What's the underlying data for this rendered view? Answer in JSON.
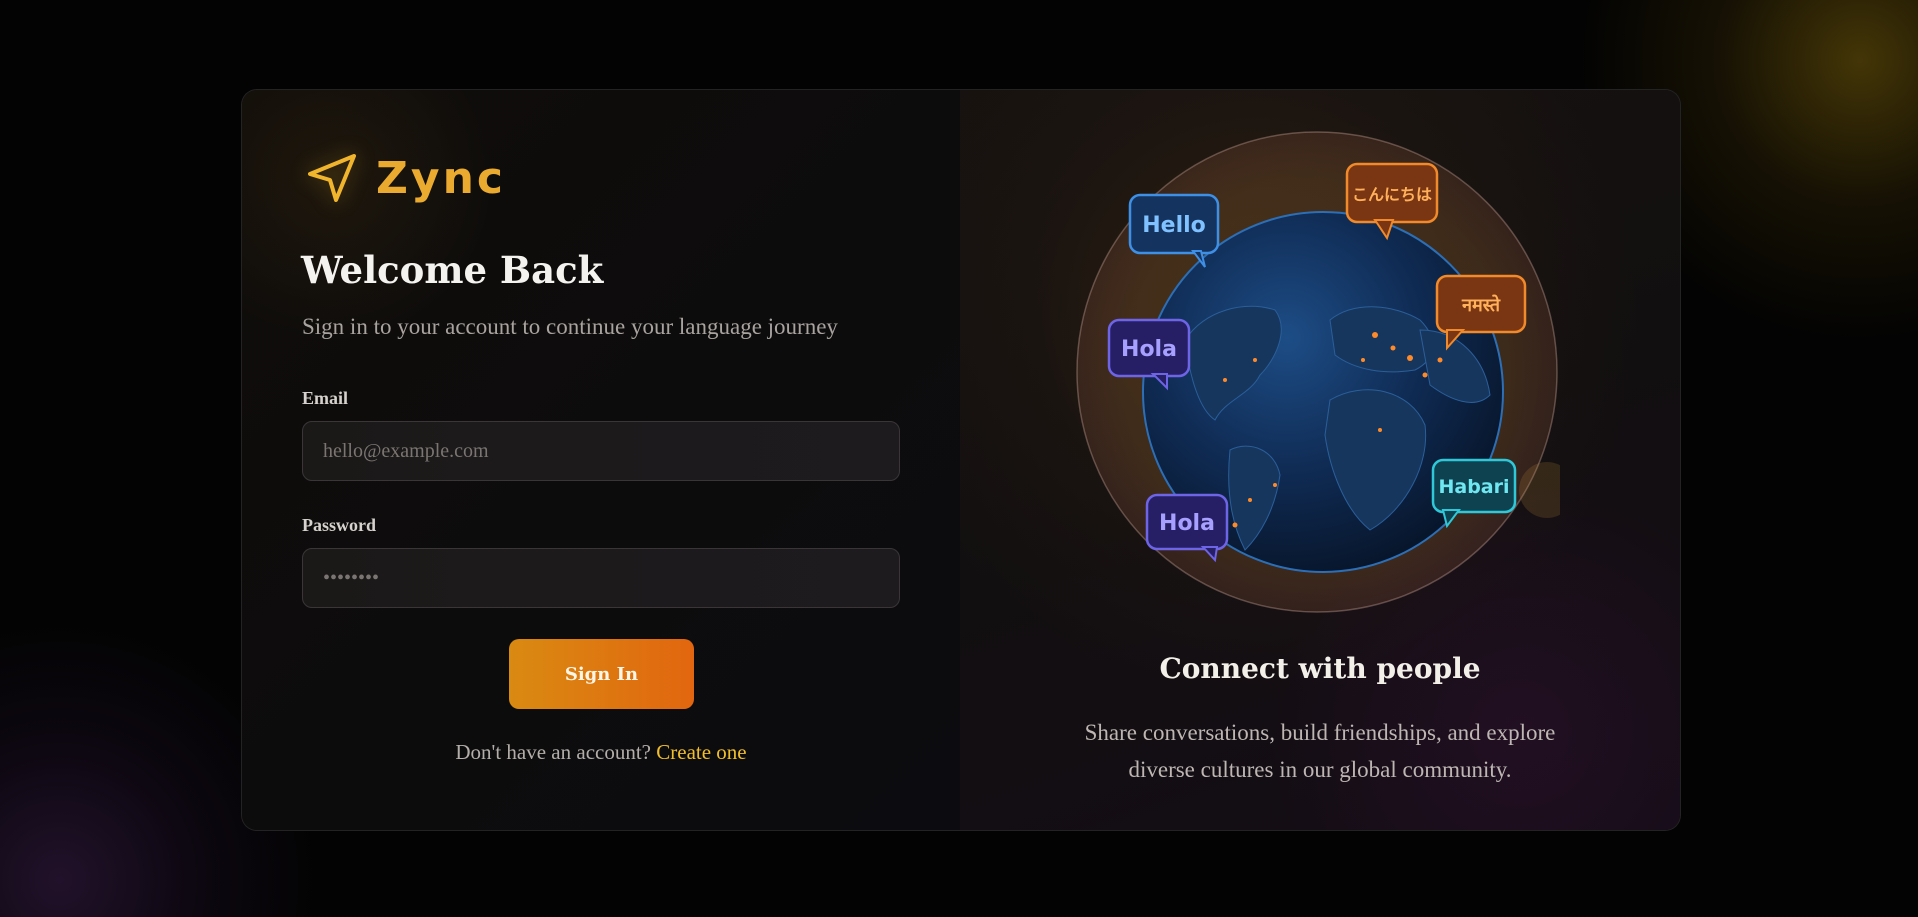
{
  "brand": {
    "name": "Zync",
    "accent_color": "#e9aa2f",
    "logo_icon": "navigation-arrow-icon"
  },
  "login": {
    "title": "Welcome Back",
    "subtitle": "Sign in to your account to continue your language journey",
    "email_label": "Email",
    "email_placeholder": "hello@example.com",
    "email_value": "",
    "password_label": "Password",
    "password_placeholder": "••••••••",
    "password_value": "",
    "submit_label": "Sign In",
    "signup_prompt": "Don't have an account?",
    "signup_link": "Create one"
  },
  "promo": {
    "bubbles": [
      "Hello",
      "こんにちは",
      "Hola",
      "नमस्ते",
      "Habari",
      "Hola"
    ],
    "title": "Connect with people",
    "description": "Share conversations, build friendships, and explore diverse cultures in our global community."
  },
  "colors": {
    "button_gradient_start": "#d98a12",
    "button_gradient_end": "#e2660f",
    "link": "#f2bf2a",
    "background": "#030303"
  }
}
